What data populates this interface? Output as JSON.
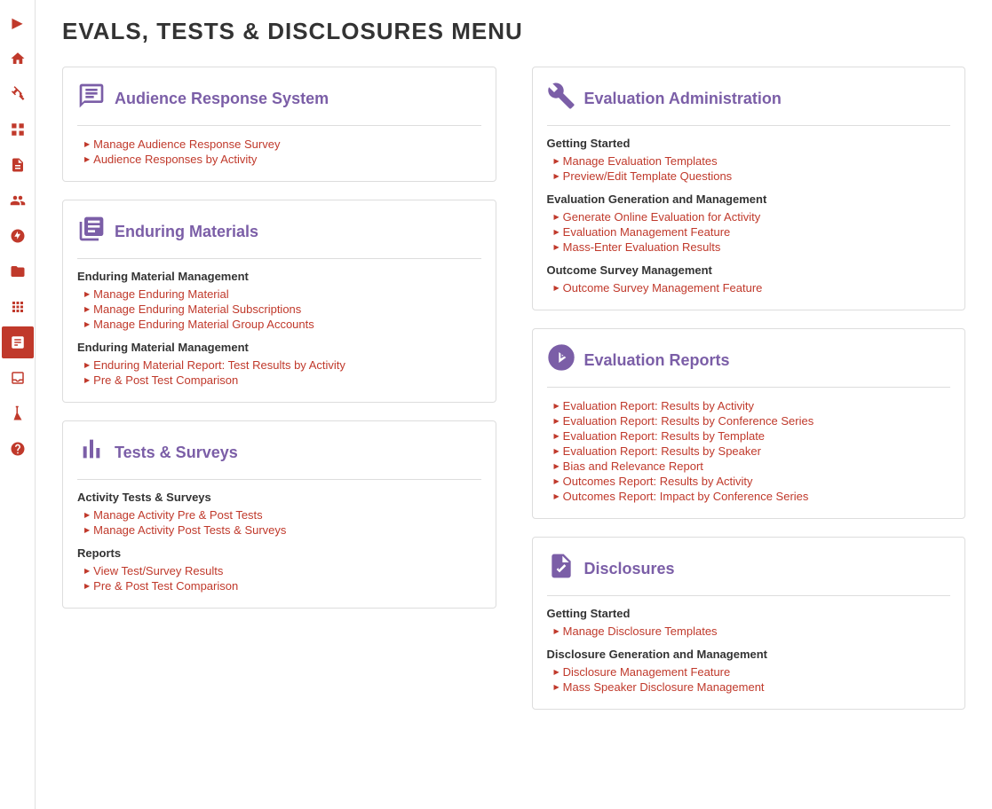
{
  "page": {
    "title": "EVALS, TESTS & DISCLOSURES MENU"
  },
  "sidebar": {
    "items": [
      {
        "name": "arrow-icon",
        "icon": "▶",
        "active": false
      },
      {
        "name": "home-icon",
        "icon": "🏠",
        "active": false
      },
      {
        "name": "tool-icon",
        "icon": "🔧",
        "active": false
      },
      {
        "name": "grid-icon",
        "icon": "⊞",
        "active": false
      },
      {
        "name": "doc-icon",
        "icon": "📄",
        "active": false
      },
      {
        "name": "person-icon",
        "icon": "👤",
        "active": false
      },
      {
        "name": "medical-icon",
        "icon": "🩺",
        "active": false
      },
      {
        "name": "folder-icon",
        "icon": "📁",
        "active": false
      },
      {
        "name": "apps-icon",
        "icon": "⊞",
        "active": false
      },
      {
        "name": "chart-icon",
        "icon": "📊",
        "active": true
      },
      {
        "name": "inbox-icon",
        "icon": "📥",
        "active": false
      },
      {
        "name": "flask-icon",
        "icon": "🧪",
        "active": false
      },
      {
        "name": "help-icon",
        "icon": "❓",
        "active": false
      }
    ]
  },
  "left_column": {
    "sections": [
      {
        "id": "audience-response",
        "title": "Audience Response System",
        "links_flat": [
          "Manage Audience Response Survey",
          "Audience Responses by Activity"
        ]
      },
      {
        "id": "enduring-materials",
        "title": "Enduring Materials",
        "subsections": [
          {
            "title": "Enduring Material Management",
            "links": [
              "Manage Enduring Material",
              "Manage Enduring Material Subscriptions",
              "Manage Enduring Material Group Accounts"
            ]
          },
          {
            "title": "Enduring Material Management",
            "links": [
              "Enduring Material Report: Test Results by Activity",
              "Pre & Post Test Comparison"
            ]
          }
        ]
      },
      {
        "id": "tests-surveys",
        "title": "Tests & Surveys",
        "subsections": [
          {
            "title": "Activity Tests & Surveys",
            "links": [
              "Manage Activity Pre & Post Tests",
              "Manage Activity Post Tests & Surveys"
            ]
          },
          {
            "title": "Reports",
            "links": [
              "View Test/Survey Results",
              "Pre & Post Test Comparison"
            ]
          }
        ]
      }
    ]
  },
  "right_column": {
    "sections": [
      {
        "id": "evaluation-admin",
        "title": "Evaluation Administration",
        "subsections": [
          {
            "title": "Getting Started",
            "links": [
              "Manage Evaluation Templates",
              "Preview/Edit Template Questions"
            ]
          },
          {
            "title": "Evaluation Generation and Management",
            "links": [
              "Generate Online Evaluation for Activity",
              "Evaluation Management Feature",
              "Mass-Enter Evaluation Results"
            ]
          },
          {
            "title": "Outcome Survey Management",
            "links": [
              "Outcome Survey Management Feature"
            ]
          }
        ]
      },
      {
        "id": "evaluation-reports",
        "title": "Evaluation Reports",
        "links_flat": [
          "Evaluation Report: Results by Activity",
          "Evaluation Report: Results by Conference Series",
          "Evaluation Report: Results by Template",
          "Evaluation Report: Results by Speaker",
          "Bias and Relevance Report",
          "Outcomes Report: Results by Activity",
          "Outcomes Report: Impact by Conference Series"
        ]
      },
      {
        "id": "disclosures",
        "title": "Disclosures",
        "subsections": [
          {
            "title": "Getting Started",
            "links": [
              "Manage Disclosure Templates"
            ]
          },
          {
            "title": "Disclosure Generation and Management",
            "links": [
              "Disclosure Management Feature",
              "Mass Speaker Disclosure Management"
            ]
          }
        ]
      }
    ]
  }
}
